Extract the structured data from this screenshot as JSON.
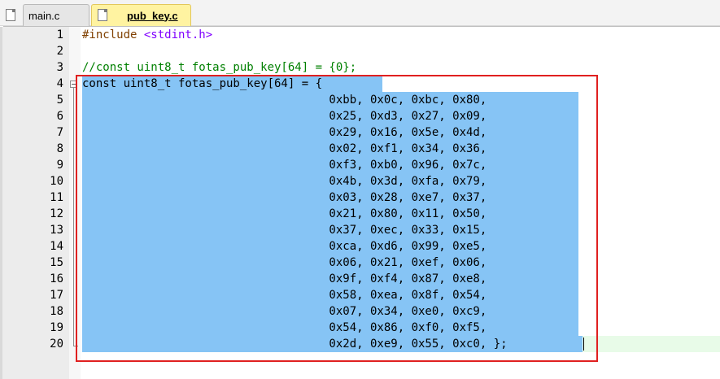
{
  "tabs": [
    {
      "label": "main.c",
      "active": false
    },
    {
      "label": "pub_key.c",
      "active": true
    }
  ],
  "lines": [
    {
      "n": "1",
      "text": "#include <stdint.h>"
    },
    {
      "n": "2",
      "text": ""
    },
    {
      "n": "3",
      "text": "//const uint8_t fotas_pub_key[64] = {0};"
    },
    {
      "n": "4",
      "text": "const uint8_t fotas_pub_key[64] = {"
    },
    {
      "n": "5",
      "text": "                                    0xbb, 0x0c, 0xbc, 0x80,"
    },
    {
      "n": "6",
      "text": "                                    0x25, 0xd3, 0x27, 0x09,"
    },
    {
      "n": "7",
      "text": "                                    0x29, 0x16, 0x5e, 0x4d,"
    },
    {
      "n": "8",
      "text": "                                    0x02, 0xf1, 0x34, 0x36,"
    },
    {
      "n": "9",
      "text": "                                    0xf3, 0xb0, 0x96, 0x7c,"
    },
    {
      "n": "10",
      "text": "                                    0x4b, 0x3d, 0xfa, 0x79,"
    },
    {
      "n": "11",
      "text": "                                    0x03, 0x28, 0xe7, 0x37,"
    },
    {
      "n": "12",
      "text": "                                    0x21, 0x80, 0x11, 0x50,"
    },
    {
      "n": "13",
      "text": "                                    0x37, 0xec, 0x33, 0x15,"
    },
    {
      "n": "14",
      "text": "                                    0xca, 0xd6, 0x99, 0xe5,"
    },
    {
      "n": "15",
      "text": "                                    0x06, 0x21, 0xef, 0x06,"
    },
    {
      "n": "16",
      "text": "                                    0x9f, 0xf4, 0x87, 0xe8,"
    },
    {
      "n": "17",
      "text": "                                    0x58, 0xea, 0x8f, 0x54,"
    },
    {
      "n": "18",
      "text": "                                    0x07, 0x34, 0xe0, 0xc9,"
    },
    {
      "n": "19",
      "text": "                                    0x54, 0x86, 0xf0, 0xf5,"
    },
    {
      "n": "20",
      "text": "                                    0x2d, 0xe9, 0x55, 0xc0, };"
    }
  ],
  "icons": {
    "file": "file-icon",
    "fold": "fold-minus-icon"
  },
  "colors": {
    "selection": "#86c4f5",
    "active_tab": "#fff3a1",
    "highlight_box": "#e02020",
    "comment": "#008000",
    "preprocessor": "#804000",
    "include_path": "#8000ff"
  }
}
